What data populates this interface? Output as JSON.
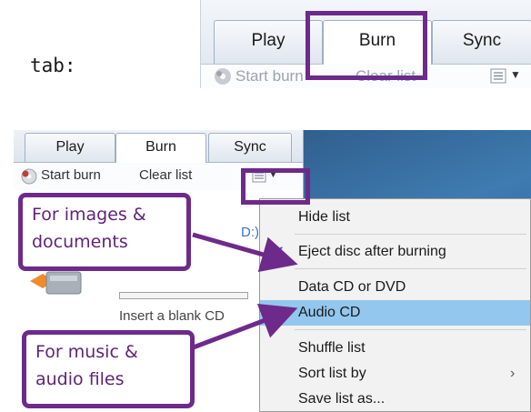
{
  "intro": {
    "text": "tab:"
  },
  "top_strip": {
    "tabs": [
      "Play",
      "Burn",
      "Sync"
    ],
    "selected_tab": "Burn",
    "toolbar": {
      "start_burn": "Start burn",
      "clear_list": "Clear list"
    }
  },
  "panel": {
    "tabs": [
      "Play",
      "Burn",
      "Sync"
    ],
    "selected_tab": "Burn",
    "toolbar": {
      "start_burn": "Start burn",
      "clear_list": "Clear list"
    },
    "drive_label": "D:)",
    "insert_prompt": "Insert a blank CD"
  },
  "menu": {
    "items": [
      {
        "label": "Hide list"
      },
      {
        "label": "Eject disc after burning",
        "checked": true
      },
      {
        "label": "Data CD or DVD"
      },
      {
        "label": "Audio CD",
        "selected": true
      },
      {
        "label": "Shuffle list"
      },
      {
        "label": "Sort list by",
        "submenu": true
      },
      {
        "label": "Save list as..."
      }
    ]
  },
  "callouts": {
    "images": "For images & documents",
    "images_lines": [
      "For images &",
      "documents"
    ],
    "music_lines": [
      "For music &",
      "audio files"
    ]
  },
  "colors": {
    "accent": "#6e2a8b",
    "menu_highlight": "#93c7ee",
    "desktop": "#3f7bb0"
  },
  "icons": [
    "burn-disc-icon",
    "list-options-icon",
    "dropdown-arrow-icon",
    "checkmark-icon",
    "radio-bullet-icon",
    "submenu-arrow-icon",
    "cd-drive-icon"
  ]
}
